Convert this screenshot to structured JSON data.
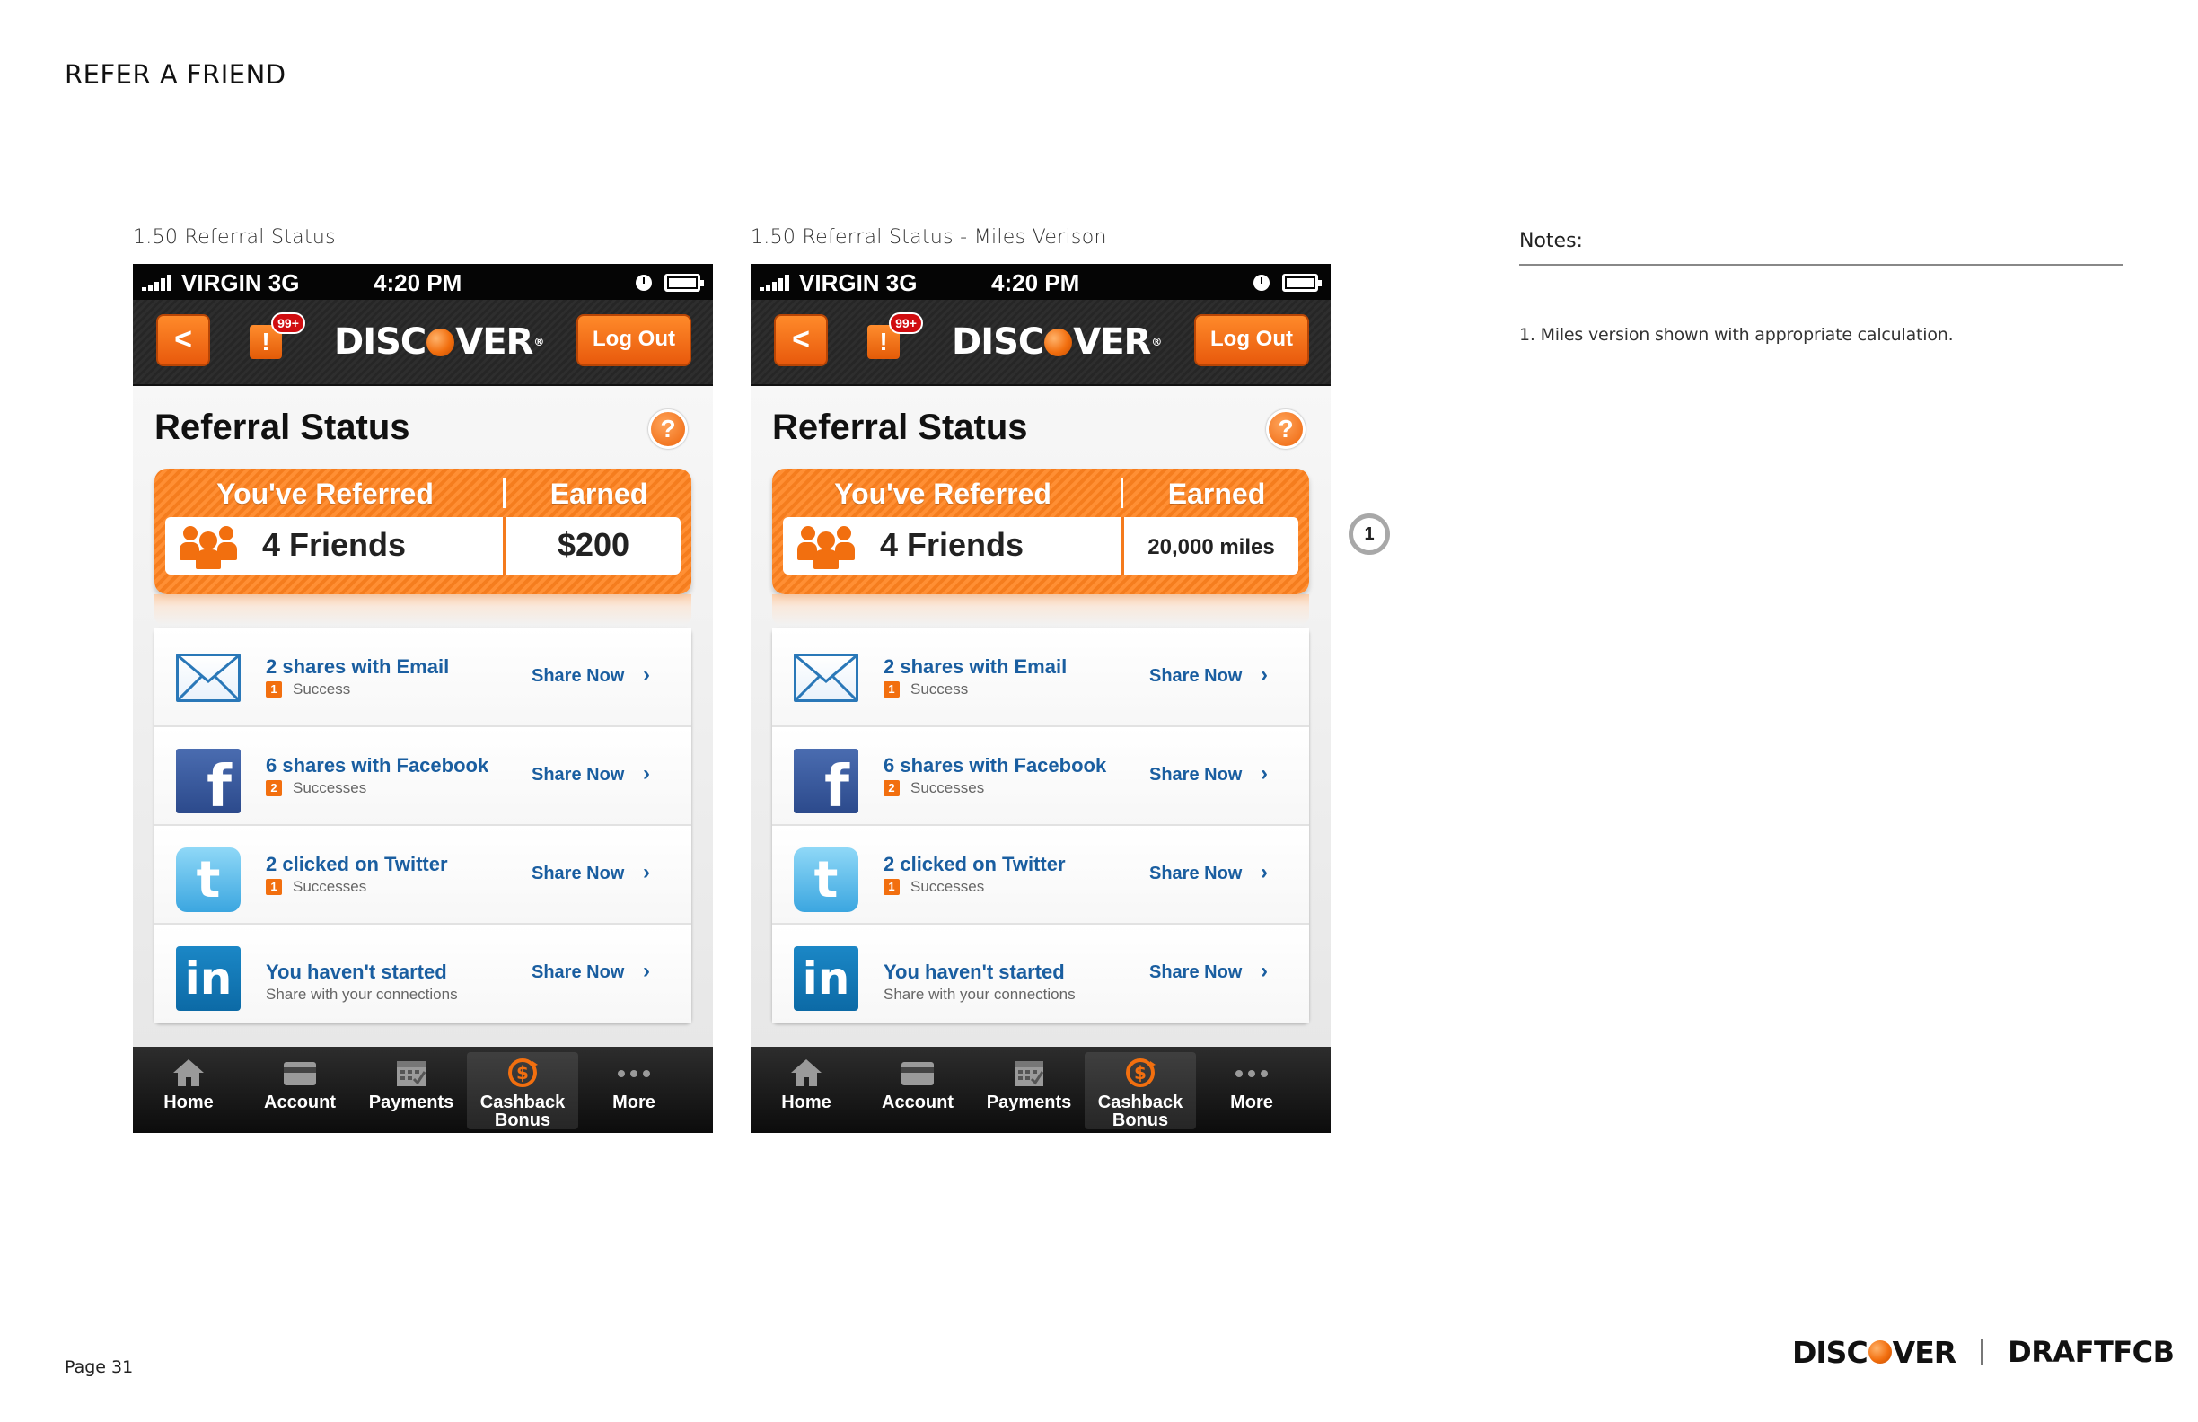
{
  "page": {
    "title": "REFER A FRIEND",
    "page_number": "Page 31",
    "footer": {
      "brand": "DISCOVER",
      "agency": "DRAFTFCB"
    }
  },
  "captions": {
    "screen1": "1.50 Referral Status",
    "screen2": "1.50 Referral Status - Miles Verison"
  },
  "status_bar": {
    "carrier": "VIRGIN  3G",
    "time": "4:20 PM"
  },
  "header": {
    "back_label": "<",
    "alert_glyph": "!",
    "alert_badge": "99+",
    "brand": "DISCOVER",
    "logout_label": "Log Out"
  },
  "screen": {
    "heading": "Referral Status",
    "help_glyph": "?",
    "summary": {
      "referred_label": "You've Referred",
      "earned_label": "Earned",
      "friends_value": "4 Friends"
    }
  },
  "screens": [
    {
      "earned_value": "$200"
    },
    {
      "earned_value": "20,000 miles"
    }
  ],
  "share_rows": [
    {
      "title": "2 shares with Email",
      "count": "1",
      "status": "Success",
      "action": "Share Now",
      "icon": "email-icon"
    },
    {
      "title": "6 shares with Facebook",
      "count": "2",
      "status": "Successes",
      "action": "Share Now",
      "icon": "facebook-icon"
    },
    {
      "title": "2 clicked on Twitter",
      "count": "1",
      "status": "Successes",
      "action": "Share Now",
      "icon": "twitter-icon"
    },
    {
      "title": "You haven't started",
      "status": "Share with your connections",
      "action": "Share Now",
      "icon": "linkedin-icon"
    }
  ],
  "icon_glyphs": {
    "facebook": "f",
    "twitter": "t",
    "linkedin": "in"
  },
  "tabs": [
    {
      "label": "Home",
      "icon": "home-icon"
    },
    {
      "label": "Account",
      "icon": "card-icon"
    },
    {
      "label": "Payments",
      "icon": "calendar-icon"
    },
    {
      "label": "Cashback Bonus",
      "icon": "cashback-icon",
      "active": true
    },
    {
      "label": "More",
      "icon": "more-dots-icon"
    }
  ],
  "annotation": {
    "marker": "1"
  },
  "notes": {
    "title": "Notes:",
    "items": [
      "1. Miles version shown with appropriate calculation."
    ]
  },
  "colors": {
    "accent_orange": "#f26f0f",
    "link_blue": "#1a5ea0",
    "badge_red": "#d10d10",
    "header_dark": "#2e2e2e"
  }
}
